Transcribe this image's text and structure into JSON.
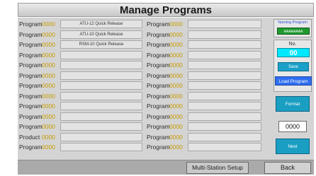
{
  "header": {
    "title": "Manage Programs"
  },
  "left_column": [
    {
      "label": "Program",
      "number": "0000",
      "name": "ATU-12 Quick Release"
    },
    {
      "label": "Program",
      "number": "0000",
      "name": "ATU-10 Quick Release"
    },
    {
      "label": "Program",
      "number": "0000",
      "name": "RSM-10 Quick Release"
    },
    {
      "label": "Program",
      "number": "0000",
      "name": ""
    },
    {
      "label": "Program",
      "number": "0000",
      "name": ""
    },
    {
      "label": "Program",
      "number": "0000",
      "name": ""
    },
    {
      "label": "Program",
      "number": "0000",
      "name": ""
    },
    {
      "label": "Program",
      "number": "0000",
      "name": ""
    },
    {
      "label": "Program",
      "number": "0000",
      "name": ""
    },
    {
      "label": "Program",
      "number": "0000",
      "name": ""
    },
    {
      "label": "Program",
      "number": "0000",
      "name": ""
    },
    {
      "label": "Product",
      "number": "0000",
      "name": ""
    },
    {
      "label": "Program",
      "number": "0000",
      "name": ""
    }
  ],
  "right_column": [
    {
      "label": "Program",
      "number": "0000",
      "name": ""
    },
    {
      "label": "Program",
      "number": "0000",
      "name": ""
    },
    {
      "label": "Program",
      "number": "0000",
      "name": ""
    },
    {
      "label": "Program",
      "number": "0000",
      "name": ""
    },
    {
      "label": "Program",
      "number": "0000",
      "name": ""
    },
    {
      "label": "Program",
      "number": "0000",
      "name": ""
    },
    {
      "label": "Program",
      "number": "0000",
      "name": ""
    },
    {
      "label": "Program",
      "number": "0000",
      "name": ""
    },
    {
      "label": "Program",
      "number": "0000",
      "name": ""
    },
    {
      "label": "Program",
      "number": "0000",
      "name": ""
    },
    {
      "label": "Program",
      "number": "0000",
      "name": ""
    },
    {
      "label": "Program",
      "number": "0000",
      "name": ""
    },
    {
      "label": "Program",
      "number": "0000",
      "name": ""
    }
  ],
  "side_panel": {
    "naming_label": "Naming Program",
    "naming_value": "AAAAAAAA",
    "no_label": "No.",
    "no_value": "00",
    "save_label": "Save",
    "load_label": "Load Program",
    "format_label": "Format",
    "counter_value": "0000",
    "next_label": "Next"
  },
  "footer": {
    "multi_station_label": "Multi-Station Setup",
    "back_label": "Back"
  },
  "colors": {
    "program_number": "#c89c00",
    "naming_value_bg": "#1f9a2f",
    "no_value_bg": "#00e8ff",
    "action_button_bg": "#1a9fc3",
    "load_button_bg": "#2f6ef0"
  }
}
